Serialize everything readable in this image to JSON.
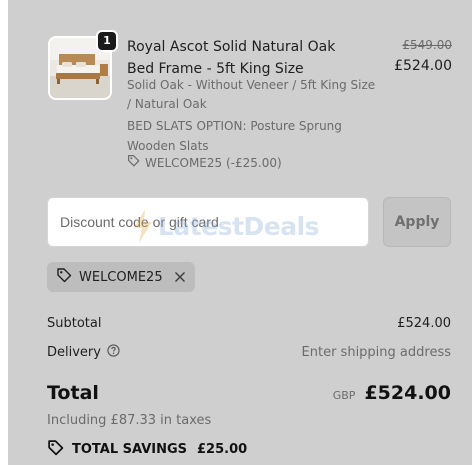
{
  "product": {
    "quantity": "1",
    "title": "Royal Ascot Solid Natural Oak Bed Frame - 5ft King Size",
    "variant": "Solid Oak - Without Veneer / 5ft King Size / Natural Oak",
    "slats_option": "BED SLATS OPTION: Posture Sprung Wooden Slats",
    "applied_discount": "WELCOME25 (-£25.00)",
    "price_original": "£549.00",
    "price_current": "£524.00",
    "image_icon": "bed-product-thumbnail"
  },
  "discount": {
    "placeholder": "Discount code or gift card",
    "apply_label": "Apply",
    "applied_code": "WELCOME25",
    "tag_icon": "tag-icon",
    "remove_icon": "close-icon"
  },
  "watermark": {
    "text": "LatestDeals"
  },
  "summary": {
    "subtotal_label": "Subtotal",
    "subtotal_value": "£524.00",
    "delivery_label": "Delivery",
    "delivery_value": "Enter shipping address",
    "total_label": "Total",
    "currency": "GBP",
    "total_value": "£524.00",
    "taxes_text": "Including £87.33 in taxes",
    "savings_label": "TOTAL SAVINGS",
    "savings_value": "£25.00"
  },
  "colors": {
    "background": "#cfcfcf",
    "badge": "#1a1a1a",
    "muted_text": "#6b6b6b",
    "button_bg": "#c4c4c4"
  }
}
